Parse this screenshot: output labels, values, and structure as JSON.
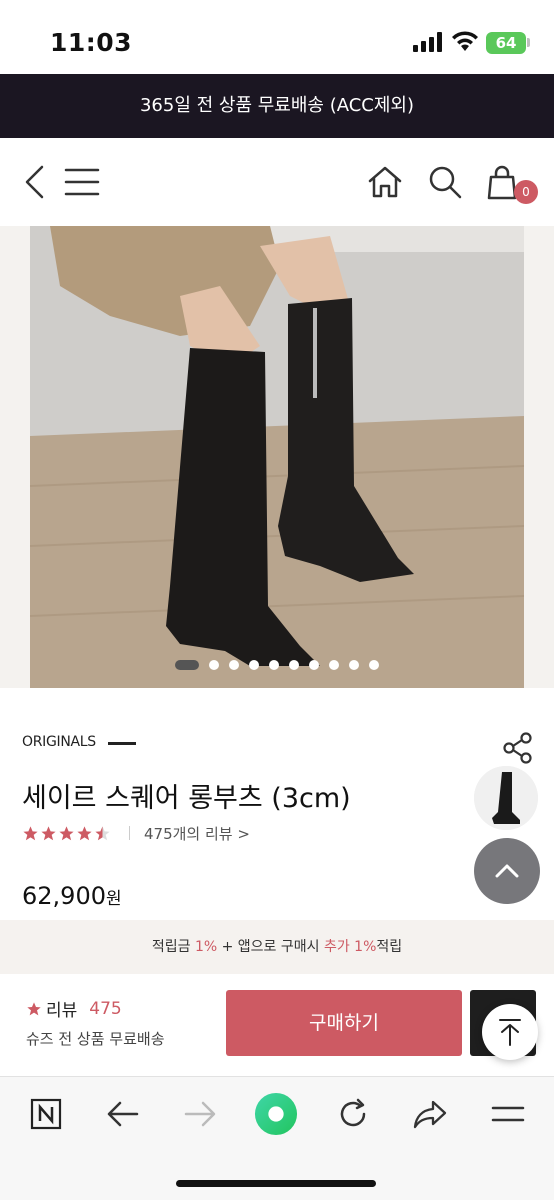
{
  "status_bar": {
    "time": "11:03",
    "battery": "64"
  },
  "promo": {
    "text": "365일 전 상품 무료배송 (ACC제외)"
  },
  "header": {
    "cart_count": "0"
  },
  "gallery": {
    "total_dots": 10,
    "active_index": 0
  },
  "product": {
    "brand": "ORIGINALS",
    "title": "세이르 스퀘어 롱부츠 (3cm)",
    "rating": 4.5,
    "review_link": "475개의 리뷰 >",
    "price_number": "62,900",
    "price_unit": "원"
  },
  "points": {
    "part1": "적립금 ",
    "pct1": "1%",
    "part2": " + 앱으로 구매시 ",
    "part3": "추가 1%",
    "part4": "적립"
  },
  "purchase": {
    "review_label": "리뷰",
    "review_count": "475",
    "shipping": "슈즈 전 상품 무료배송",
    "buy_label": "구매하기"
  },
  "colors": {
    "accent": "#cd5a63",
    "banner": "#1b1622"
  }
}
